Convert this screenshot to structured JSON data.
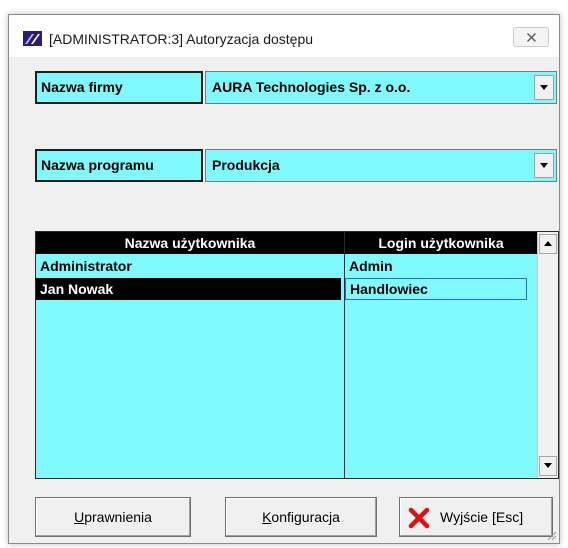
{
  "window": {
    "title": "[ADMINISTRATOR:3]  Autoryzacja dostępu"
  },
  "company": {
    "label": "Nazwa firmy",
    "value": "AURA Technologies Sp. z o.o."
  },
  "program": {
    "label": "Nazwa programu",
    "value": "Produkcja"
  },
  "users_table": {
    "columns": [
      "Nazwa użytkownika",
      "Login użytkownika"
    ],
    "rows": [
      {
        "name": "Administrator",
        "login": "Admin"
      },
      {
        "name": "Jan Nowak",
        "login": "Handlowiec"
      }
    ],
    "selected_row": 1
  },
  "buttons": {
    "permissions": {
      "accel": "U",
      "rest": "prawnienia"
    },
    "configuration": {
      "accel": "K",
      "rest": "onfiguracja"
    },
    "exit": {
      "label": "Wyjście  [Esc]",
      "icon": "red-x-icon"
    }
  },
  "colors": {
    "field_background": "#7ff9fb",
    "header_background": "#000000",
    "exit_icon": "#e01010"
  }
}
